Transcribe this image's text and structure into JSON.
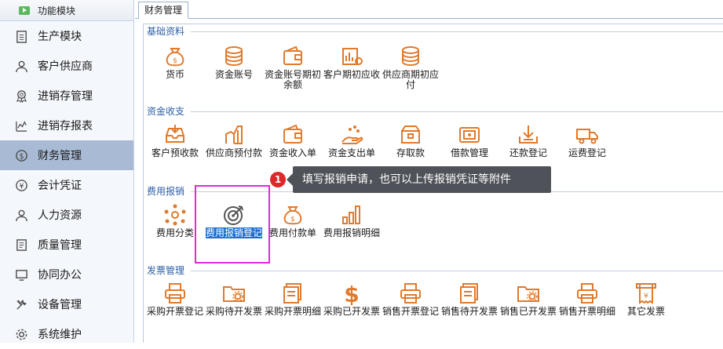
{
  "sidebar": {
    "header": "功能模块",
    "items": [
      {
        "label": "生产模块",
        "icon": "clipboard-icon"
      },
      {
        "label": "客户供应商",
        "icon": "person-icon"
      },
      {
        "label": "进销存管理",
        "icon": "medal-icon"
      },
      {
        "label": "进销存报表",
        "icon": "chart-icon"
      },
      {
        "label": "财务管理",
        "icon": "money-icon",
        "active": true
      },
      {
        "label": "会计凭证",
        "icon": "yen-circle-icon"
      },
      {
        "label": "人力资源",
        "icon": "person-icon"
      },
      {
        "label": "质量管理",
        "icon": "document-icon"
      },
      {
        "label": "协同办公",
        "icon": "monitor-icon"
      },
      {
        "label": "设备管理",
        "icon": "tools-icon"
      },
      {
        "label": "系统维护",
        "icon": "gear-icon"
      }
    ]
  },
  "tab": {
    "label": "财务管理"
  },
  "sections": {
    "basic": {
      "title": "基础资料",
      "tools": [
        "货币",
        "资金账号",
        "资金账号期初余额",
        "客户期初应收",
        "供应商期初应付"
      ]
    },
    "funds": {
      "title": "资金收支",
      "tools": [
        "客户预收款",
        "供应商预付款",
        "资金收入单",
        "资金支出单",
        "存取款",
        "借款管理",
        "还款登记",
        "运费登记"
      ]
    },
    "expense": {
      "title": "费用报销",
      "tools": [
        "费用分类",
        "费用报销登记",
        "费用付款单",
        "费用报销明细"
      ]
    },
    "invoice": {
      "title": "发票管理",
      "tools": [
        "采购开票登记",
        "采购待开发票",
        "采购开票明细",
        "采购已开发票",
        "销售开票登记",
        "销售待开发票",
        "销售已开发票",
        "销售开票明细",
        "其它发票"
      ]
    }
  },
  "tooltip": {
    "badge": "1",
    "text": "填写报销申请，也可以上传报销凭证等附件"
  },
  "colors": {
    "icon": "#e07a2c",
    "accent": "#2d5ea5",
    "highlight": "#e626d8",
    "selected": "#1c6fd1"
  }
}
